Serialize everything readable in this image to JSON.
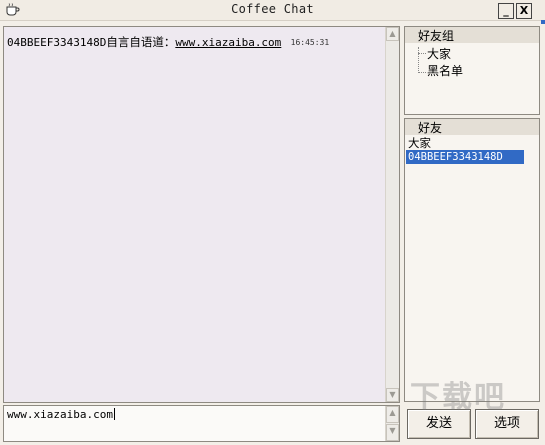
{
  "window": {
    "title": "Coffee Chat",
    "min_label": "_",
    "close_label": "X"
  },
  "chat": {
    "message": {
      "sender": "04BBEEF3343148D",
      "action": "自言自语道：",
      "link": "www.xiazaiba.com",
      "time": "16:45:31"
    }
  },
  "input": {
    "value": "www.xiazaiba.com"
  },
  "groups": {
    "header": "好友组",
    "items": [
      "大家",
      "黑名单"
    ]
  },
  "friends": {
    "header": "好友",
    "items": [
      "大家",
      "04BBEEF3343148D"
    ],
    "selected_index": 1
  },
  "buttons": {
    "send": "发送",
    "options": "选项"
  },
  "watermark": {
    "text": "下载吧"
  },
  "colors": {
    "selection": "#316ac5",
    "chat_bg": "#eee9f0"
  },
  "scroll_icons": {
    "up": "arrow-up-icon",
    "down": "arrow-down-icon"
  }
}
